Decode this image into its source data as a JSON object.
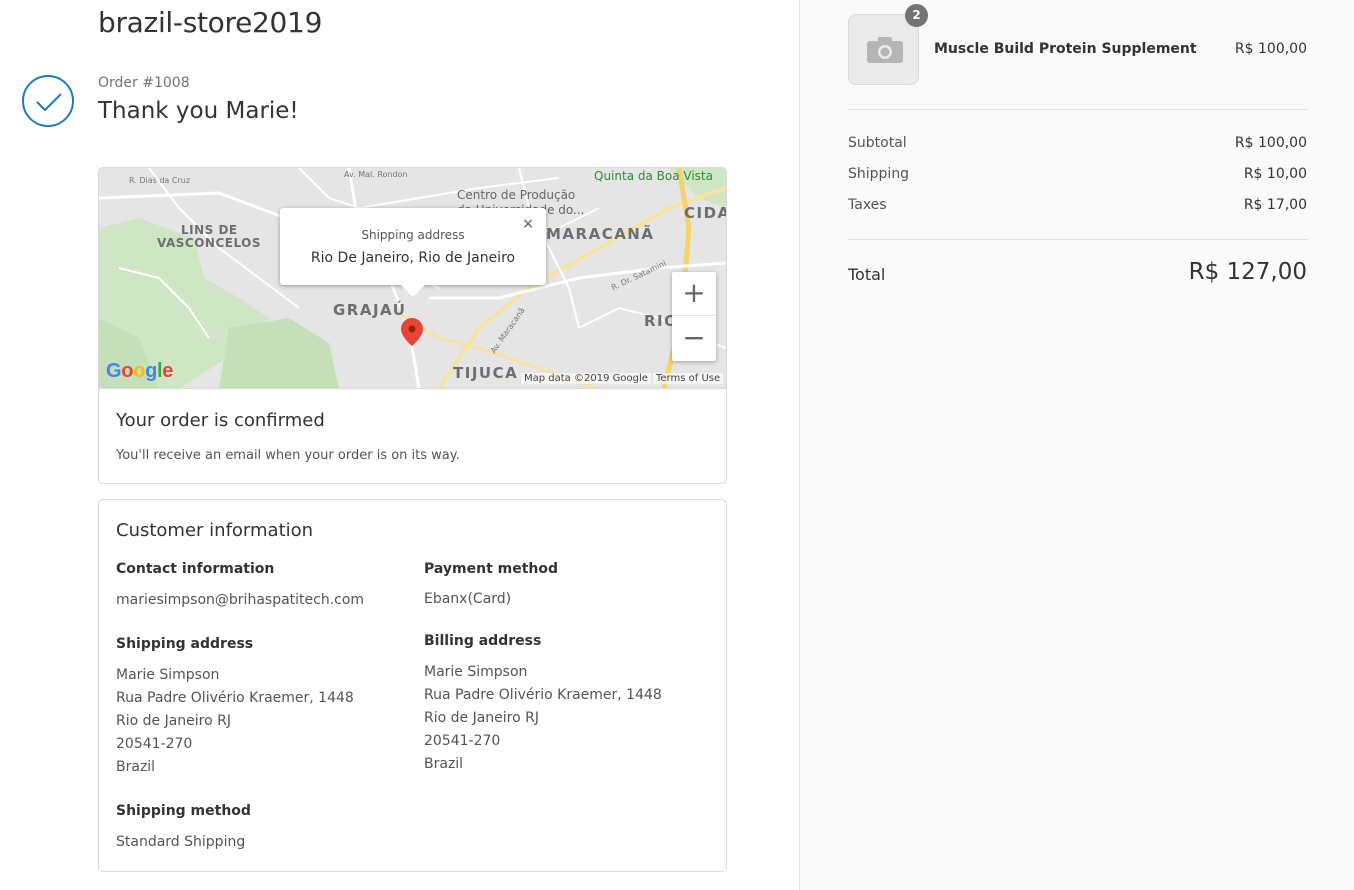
{
  "store": {
    "name": "brazil-store2019"
  },
  "order": {
    "number": "Order #1008",
    "thank_you": "Thank you Marie!"
  },
  "map": {
    "popup_title": "Shipping address",
    "popup_value": "Rio De Janeiro, Rio de Janeiro",
    "popup_close": "×",
    "zoom_in": "+",
    "zoom_out": "−",
    "google": "Google",
    "map_data": "Map data ©2019 Google",
    "terms": "Terms of Use",
    "labels": {
      "dias_da_cruz": "R. Dias da Cruz",
      "mal_rondon": "Av. Mal. Rondon",
      "lins": "LINS DE",
      "vasconcelos": "VASCONCELOS",
      "centro1": "Centro de Produção",
      "centro2": "da Universidade do...",
      "quinta": "Quinta da Boa Vista",
      "cida": "CIDA",
      "maracana": "MARACANÃ",
      "dr_satamini": "R. Dr. Satamini",
      "grajau": "GRAJAÚ",
      "av_maracana": "Av. Maracanã",
      "rio": "RIO C",
      "tijuca": "TIJUCA"
    }
  },
  "confirmation": {
    "title": "Your order is confirmed",
    "text": "You'll receive an email when your order is on its way."
  },
  "customer": {
    "title": "Customer information",
    "contact": {
      "heading": "Contact information",
      "email": "mariesimpson@brihaspatitech.com"
    },
    "payment": {
      "heading": "Payment method",
      "value": "Ebanx(Card)"
    },
    "shipping_address": {
      "heading": "Shipping address",
      "lines": [
        "Marie Simpson",
        "Rua Padre Olivério Kraemer, 1448",
        "Rio de Janeiro RJ",
        "20541-270",
        "Brazil"
      ]
    },
    "billing_address": {
      "heading": "Billing address",
      "lines": [
        "Marie Simpson",
        "Rua Padre Olivério Kraemer, 1448",
        "Rio de Janeiro RJ",
        "20541-270",
        "Brazil"
      ]
    },
    "shipping_method": {
      "heading": "Shipping method",
      "value": "Standard Shipping"
    }
  },
  "summary": {
    "product": {
      "name": "Muscle Build Protein Supplement",
      "price": "R$ 100,00",
      "quantity": "2",
      "icon": "camera-icon"
    },
    "subtotal": {
      "label": "Subtotal",
      "value": "R$ 100,00"
    },
    "shipping": {
      "label": "Shipping",
      "value": "R$ 10,00"
    },
    "taxes": {
      "label": "Taxes",
      "value": "R$ 17,00"
    },
    "total": {
      "label": "Total",
      "value": "R$ 127,00"
    }
  },
  "colors": {
    "accent": "#1f7bb6",
    "marker": "#ea4335",
    "sidebar_bg": "#fafafa"
  }
}
